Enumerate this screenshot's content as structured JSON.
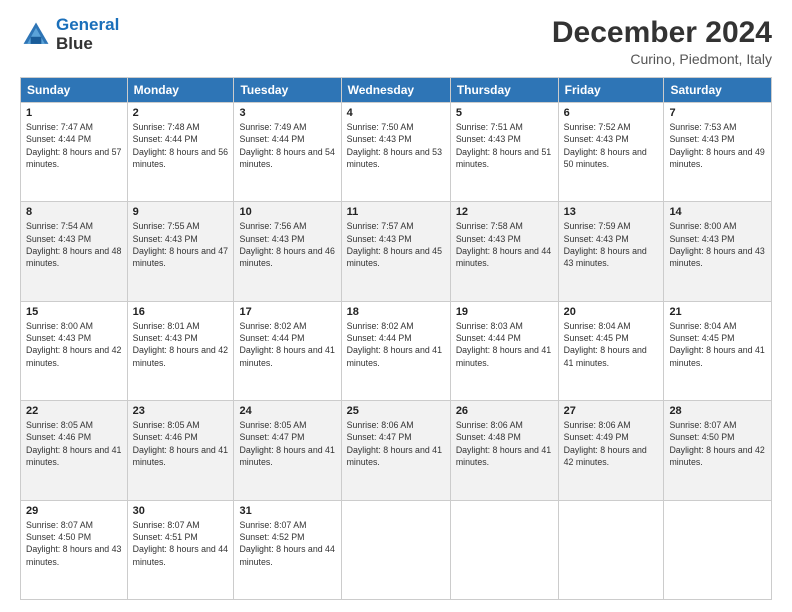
{
  "header": {
    "logo_line1": "General",
    "logo_line2": "Blue",
    "title": "December 2024",
    "subtitle": "Curino, Piedmont, Italy"
  },
  "weekdays": [
    "Sunday",
    "Monday",
    "Tuesday",
    "Wednesday",
    "Thursday",
    "Friday",
    "Saturday"
  ],
  "weeks": [
    [
      {
        "day": "1",
        "sunrise": "Sunrise: 7:47 AM",
        "sunset": "Sunset: 4:44 PM",
        "daylight": "Daylight: 8 hours and 57 minutes."
      },
      {
        "day": "2",
        "sunrise": "Sunrise: 7:48 AM",
        "sunset": "Sunset: 4:44 PM",
        "daylight": "Daylight: 8 hours and 56 minutes."
      },
      {
        "day": "3",
        "sunrise": "Sunrise: 7:49 AM",
        "sunset": "Sunset: 4:44 PM",
        "daylight": "Daylight: 8 hours and 54 minutes."
      },
      {
        "day": "4",
        "sunrise": "Sunrise: 7:50 AM",
        "sunset": "Sunset: 4:43 PM",
        "daylight": "Daylight: 8 hours and 53 minutes."
      },
      {
        "day": "5",
        "sunrise": "Sunrise: 7:51 AM",
        "sunset": "Sunset: 4:43 PM",
        "daylight": "Daylight: 8 hours and 51 minutes."
      },
      {
        "day": "6",
        "sunrise": "Sunrise: 7:52 AM",
        "sunset": "Sunset: 4:43 PM",
        "daylight": "Daylight: 8 hours and 50 minutes."
      },
      {
        "day": "7",
        "sunrise": "Sunrise: 7:53 AM",
        "sunset": "Sunset: 4:43 PM",
        "daylight": "Daylight: 8 hours and 49 minutes."
      }
    ],
    [
      {
        "day": "8",
        "sunrise": "Sunrise: 7:54 AM",
        "sunset": "Sunset: 4:43 PM",
        "daylight": "Daylight: 8 hours and 48 minutes."
      },
      {
        "day": "9",
        "sunrise": "Sunrise: 7:55 AM",
        "sunset": "Sunset: 4:43 PM",
        "daylight": "Daylight: 8 hours and 47 minutes."
      },
      {
        "day": "10",
        "sunrise": "Sunrise: 7:56 AM",
        "sunset": "Sunset: 4:43 PM",
        "daylight": "Daylight: 8 hours and 46 minutes."
      },
      {
        "day": "11",
        "sunrise": "Sunrise: 7:57 AM",
        "sunset": "Sunset: 4:43 PM",
        "daylight": "Daylight: 8 hours and 45 minutes."
      },
      {
        "day": "12",
        "sunrise": "Sunrise: 7:58 AM",
        "sunset": "Sunset: 4:43 PM",
        "daylight": "Daylight: 8 hours and 44 minutes."
      },
      {
        "day": "13",
        "sunrise": "Sunrise: 7:59 AM",
        "sunset": "Sunset: 4:43 PM",
        "daylight": "Daylight: 8 hours and 43 minutes."
      },
      {
        "day": "14",
        "sunrise": "Sunrise: 8:00 AM",
        "sunset": "Sunset: 4:43 PM",
        "daylight": "Daylight: 8 hours and 43 minutes."
      }
    ],
    [
      {
        "day": "15",
        "sunrise": "Sunrise: 8:00 AM",
        "sunset": "Sunset: 4:43 PM",
        "daylight": "Daylight: 8 hours and 42 minutes."
      },
      {
        "day": "16",
        "sunrise": "Sunrise: 8:01 AM",
        "sunset": "Sunset: 4:43 PM",
        "daylight": "Daylight: 8 hours and 42 minutes."
      },
      {
        "day": "17",
        "sunrise": "Sunrise: 8:02 AM",
        "sunset": "Sunset: 4:44 PM",
        "daylight": "Daylight: 8 hours and 41 minutes."
      },
      {
        "day": "18",
        "sunrise": "Sunrise: 8:02 AM",
        "sunset": "Sunset: 4:44 PM",
        "daylight": "Daylight: 8 hours and 41 minutes."
      },
      {
        "day": "19",
        "sunrise": "Sunrise: 8:03 AM",
        "sunset": "Sunset: 4:44 PM",
        "daylight": "Daylight: 8 hours and 41 minutes."
      },
      {
        "day": "20",
        "sunrise": "Sunrise: 8:04 AM",
        "sunset": "Sunset: 4:45 PM",
        "daylight": "Daylight: 8 hours and 41 minutes."
      },
      {
        "day": "21",
        "sunrise": "Sunrise: 8:04 AM",
        "sunset": "Sunset: 4:45 PM",
        "daylight": "Daylight: 8 hours and 41 minutes."
      }
    ],
    [
      {
        "day": "22",
        "sunrise": "Sunrise: 8:05 AM",
        "sunset": "Sunset: 4:46 PM",
        "daylight": "Daylight: 8 hours and 41 minutes."
      },
      {
        "day": "23",
        "sunrise": "Sunrise: 8:05 AM",
        "sunset": "Sunset: 4:46 PM",
        "daylight": "Daylight: 8 hours and 41 minutes."
      },
      {
        "day": "24",
        "sunrise": "Sunrise: 8:05 AM",
        "sunset": "Sunset: 4:47 PM",
        "daylight": "Daylight: 8 hours and 41 minutes."
      },
      {
        "day": "25",
        "sunrise": "Sunrise: 8:06 AM",
        "sunset": "Sunset: 4:47 PM",
        "daylight": "Daylight: 8 hours and 41 minutes."
      },
      {
        "day": "26",
        "sunrise": "Sunrise: 8:06 AM",
        "sunset": "Sunset: 4:48 PM",
        "daylight": "Daylight: 8 hours and 41 minutes."
      },
      {
        "day": "27",
        "sunrise": "Sunrise: 8:06 AM",
        "sunset": "Sunset: 4:49 PM",
        "daylight": "Daylight: 8 hours and 42 minutes."
      },
      {
        "day": "28",
        "sunrise": "Sunrise: 8:07 AM",
        "sunset": "Sunset: 4:50 PM",
        "daylight": "Daylight: 8 hours and 42 minutes."
      }
    ],
    [
      {
        "day": "29",
        "sunrise": "Sunrise: 8:07 AM",
        "sunset": "Sunset: 4:50 PM",
        "daylight": "Daylight: 8 hours and 43 minutes."
      },
      {
        "day": "30",
        "sunrise": "Sunrise: 8:07 AM",
        "sunset": "Sunset: 4:51 PM",
        "daylight": "Daylight: 8 hours and 44 minutes."
      },
      {
        "day": "31",
        "sunrise": "Sunrise: 8:07 AM",
        "sunset": "Sunset: 4:52 PM",
        "daylight": "Daylight: 8 hours and 44 minutes."
      },
      null,
      null,
      null,
      null
    ]
  ]
}
